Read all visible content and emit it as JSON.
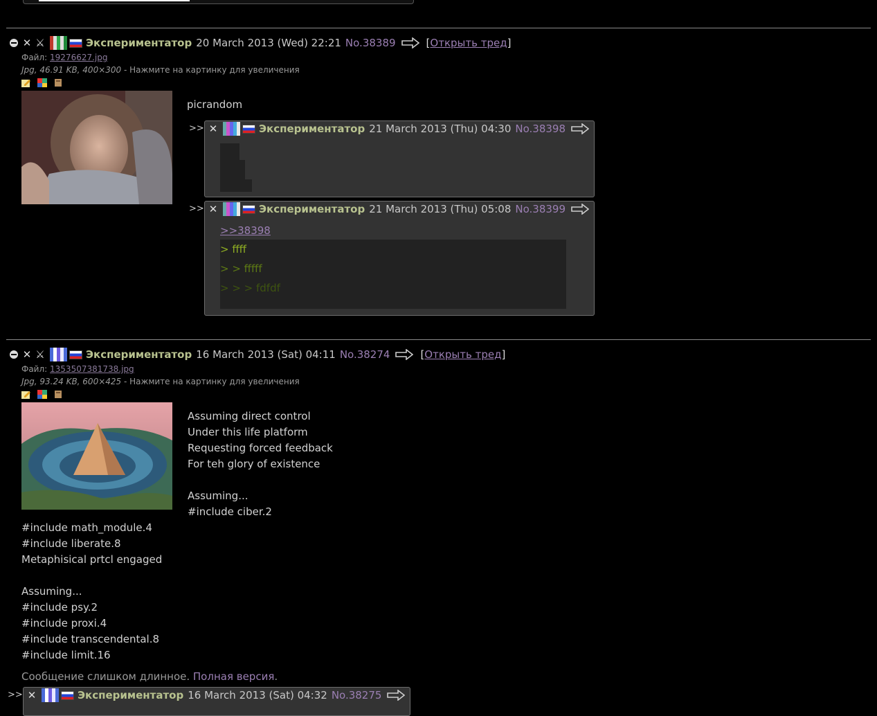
{
  "posts": [
    {
      "name": "Экспериментатор",
      "date": "20 March 2013 (Wed) 22:21",
      "no": "No.38389",
      "open_thread": "Открыть тред",
      "file_label": "Файл:",
      "file_name": "19276627.jpg",
      "file_meta": "Jpg, 46.91 KB, 400×300",
      "file_hint": " - Нажмите на картинку для увеличения",
      "text": "picrandom"
    },
    {
      "name": "Экспериментатор",
      "date": "16 March 2013 (Sat) 04:11",
      "no": "No.38274",
      "open_thread": "Открыть тред",
      "file_label": "Файл:",
      "file_name": "1353507381738.jpg",
      "file_meta": "Jpg, 93.24 KB, 600×425",
      "file_hint": " - Нажмите на картинку для увеличения",
      "text_right": "Assuming direct control\nUnder this life platform\nRequesting forced feedback\nFor teh glory of existence\n\nAssuming...\n#include ciber.2",
      "text_below": "#include math_module.4\n#include liberate.8\nMetaphisical prtcl engaged\n\nAssuming...\n#include psy.2\n#include proxi.4\n#include transcendental.8\n#include limit.16",
      "too_long": "Сообщение слишком длинное.",
      "full_version": "Полная версия",
      "full_dot": "."
    }
  ],
  "replies": [
    {
      "marker": ">>",
      "name": "Экспериментатор",
      "date": "21 March 2013 (Thu) 04:30",
      "no": "No.38398"
    },
    {
      "marker": ">>",
      "name": "Экспериментатор",
      "date": "21 March 2013 (Thu) 05:08",
      "no": "No.38399",
      "ref": ">>38398",
      "q1": "> ffff",
      "q2": "> > fffff",
      "q3": "> > > fdfdf"
    },
    {
      "marker": ">>",
      "name": "Экспериментатор",
      "date": "16 March 2013 (Sat) 04:32",
      "no": "No.38275"
    }
  ],
  "icons": [
    "minus-circle-icon",
    "close-icon",
    "hide-icon",
    "flag-icon",
    "arrow-right-icon",
    "edit-icon",
    "google-icon",
    "iqdb-icon"
  ],
  "colors": {
    "name": "#b8c28f",
    "postno": "#9b7fb3",
    "quote1": "#8fae22",
    "reply_bg": "#333333"
  }
}
